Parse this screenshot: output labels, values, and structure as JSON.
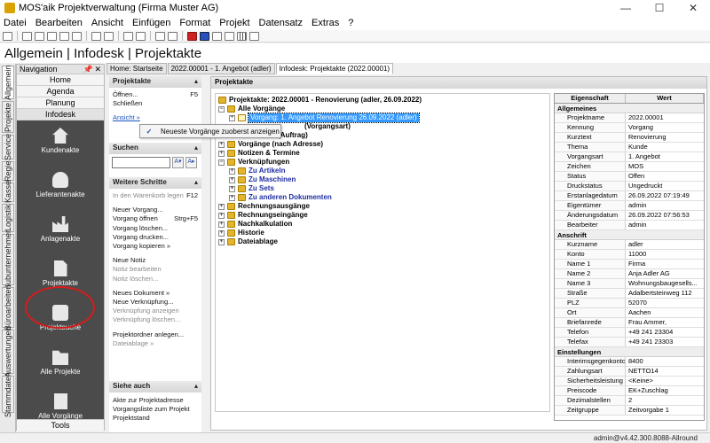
{
  "window": {
    "title": "MOS'aik Projektverwaltung (Firma Muster AG)",
    "minimize": "—",
    "maximize": "☐",
    "close": "✕"
  },
  "menu": [
    "Datei",
    "Bearbeiten",
    "Ansicht",
    "Einfügen",
    "Format",
    "Projekt",
    "Datensatz",
    "Extras",
    "?"
  ],
  "header": {
    "title": "Allgemein | Infodesk | Projektakte"
  },
  "vtabs": [
    "Allgemein",
    "Projekte",
    "Service",
    "Regie",
    "Kasse",
    "Logistik",
    "Subunternehmer",
    "Büroarbeiten",
    "Auswertungen",
    "Stammdaten"
  ],
  "nav": {
    "title": "Navigation",
    "pin": "📌",
    "close": "✕",
    "buttons": [
      "Home",
      "Agenda",
      "Planung",
      "Infodesk"
    ],
    "items": [
      "Kundenakte",
      "Lieferantenakte",
      "Anlagenakte",
      "Projektakte",
      "Projektsuche",
      "Alle Projekte",
      "Alle Vorgänge"
    ],
    "tools": "Tools"
  },
  "doctabs": [
    "Home: Startseite",
    "2022.00001 - 1. Angebot (adler)",
    "Infodesk: Projektakte (2022.00001)"
  ],
  "actions": {
    "projektakte": {
      "title": "Projektakte",
      "open": "Öffnen...",
      "open_key": "F5",
      "close": "Schließen",
      "view": "Ansicht »"
    },
    "suchen": {
      "title": "Suchen",
      "btn1": "A▾",
      "btn2": "A▸"
    },
    "weitere": {
      "title": "Weitere Schritte",
      "warenkorb": "In den Warenkorb legen",
      "warenkorb_key": "F12",
      "v_new": "Neuer Vorgang...",
      "v_open": "Vorgang öffnen",
      "v_open_key": "Strg+F5",
      "v_delete": "Vorgang löschen...",
      "v_print": "Vorgang drucken...",
      "v_copy": "Vorgang kopieren »",
      "n_new": "Neue Notiz",
      "n_edit": "Notiz bearbeiten",
      "n_delete": "Notiz löschen...",
      "d_new": "Neues Dokument »",
      "d_link": "Neue Verknüpfung...",
      "d_show": "Verknüpfung anzeigen",
      "d_del": "Verknüpfung löschen...",
      "folder": "Projektordner anlegen...",
      "ablage": "Dateiablage »"
    },
    "siehe": {
      "title": "Siehe auch",
      "l1": "Akte zur Projektadresse",
      "l2": "Vorgangsliste zum Projekt",
      "l3": "Projektstand"
    }
  },
  "popup": {
    "check": "✓",
    "label": "Neueste Vorgänge zuoberst anzeigen"
  },
  "main": {
    "title": "Projektakte",
    "tree": {
      "root": "Projektakte: 2022.00001 - Renovierung (adler, 26.09.2022)",
      "alle": "Alle Vorgänge",
      "selected": "Vorgang: 1. Angebot Renovierung 26.09.2022 (adler)",
      "hidden1": "(Vorgangsart)",
      "hidden2": "(Auftrag)",
      "adresse": "Vorgänge (nach Adresse)",
      "notizen": "Notizen & Termine",
      "verkn": "Verknüpfungen",
      "artikeln": "Zu Artikeln",
      "maschinen": "Zu Maschinen",
      "sets": "Zu Sets",
      "dokumente": "Zu anderen Dokumenten",
      "rausgang": "Rechnungsausgänge",
      "reingang": "Rechnungseingänge",
      "nachkalk": "Nachkalkulation",
      "historie": "Historie",
      "ablage": "Dateiablage"
    },
    "grid": {
      "col_prop": "Eigenschaft",
      "col_val": "Wert",
      "sections": [
        {
          "name": "Allgemeines",
          "rows": [
            [
              "Projektname",
              "2022.00001"
            ],
            [
              "Kennung",
              "Vorgang"
            ],
            [
              "Kurztext",
              "Renovierung"
            ],
            [
              "Thema",
              "Kunde"
            ],
            [
              "Vorgangsart",
              "1. Angebot"
            ],
            [
              "Zeichen",
              "MOS"
            ],
            [
              "Status",
              "Offen"
            ],
            [
              "Druckstatus",
              "Ungedruckt"
            ],
            [
              "Erstanlagedatum",
              "26.09.2022 07:19:49"
            ],
            [
              "Eigentümer",
              "admin"
            ],
            [
              "Änderungsdatum",
              "26.09.2022 07:56:53"
            ],
            [
              "Bearbeiter",
              "admin"
            ]
          ]
        },
        {
          "name": "Anschrift",
          "rows": [
            [
              "Kurzname",
              "adler"
            ],
            [
              "Konto",
              "11000"
            ],
            [
              "Name 1",
              "Firma"
            ],
            [
              "Name 2",
              "Anja Adler AG"
            ],
            [
              "Name 3",
              "Wohnungsbaugesells..."
            ],
            [
              "Straße",
              "Adalbertsteinweg 112"
            ],
            [
              "PLZ",
              "52070"
            ],
            [
              "Ort",
              "Aachen"
            ],
            [
              "Briefanrede",
              "Frau Ammer,"
            ],
            [
              "Telefon",
              "+49 241 23304"
            ],
            [
              "Telefax",
              "+49 241 23303"
            ]
          ]
        },
        {
          "name": "Einstellungen",
          "rows": [
            [
              "Interimsgegenkonto",
              "8400"
            ],
            [
              "Zahlungsart",
              "NETTO14"
            ],
            [
              "Sicherheitsleistung",
              "<Keine>"
            ],
            [
              "Preiscode",
              "EK+Zuschlag"
            ],
            [
              "Dezimalstellen",
              "2"
            ],
            [
              "Zeitgruppe",
              "Zeitvorgabe 1"
            ]
          ]
        }
      ]
    }
  },
  "status": {
    "text": "admin@v4.42.300.8088-Allround"
  }
}
